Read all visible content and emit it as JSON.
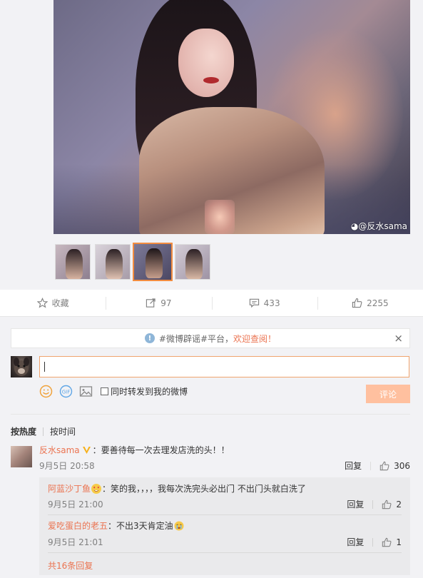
{
  "photo": {
    "watermark": "@反水sama"
  },
  "thumbnails": {
    "count": 4,
    "active_index": 2
  },
  "actions": {
    "favorite": "收藏",
    "repost": "97",
    "comment": "433",
    "like": "2255",
    "active": "comment"
  },
  "notice": {
    "text": "#微博辟谣#平台，",
    "link": "欢迎查阅！",
    "close": "×"
  },
  "composer": {
    "input_value": "",
    "also_repost": "同时转发到我的微博",
    "submit": "评论"
  },
  "sort": {
    "hot": "按热度",
    "time": "按时间"
  },
  "comment": {
    "user": "反水sama",
    "text": "：要善待每一次去理发店洗的头！！",
    "time": "9月5日 20:58",
    "reply": "回复",
    "likes": "306"
  },
  "replies": [
    {
      "user": "阿蓝沙丁鱼",
      "text": "：笑的我，，，，我每次洗完头必出门 不出门头就白洗了",
      "time": "9月5日 21:00",
      "reply": "回复",
      "likes": "2"
    },
    {
      "user": "爱吃蛋白的老五",
      "text": "：不出3天肯定油",
      "time": "9月5日 21:01",
      "reply": "回复",
      "likes": "1"
    }
  ],
  "more_replies": "共16条回复",
  "colors": {
    "accent": "#eb7350",
    "submit_bg": "#ffc09f",
    "input_border": "#f0a46e"
  }
}
